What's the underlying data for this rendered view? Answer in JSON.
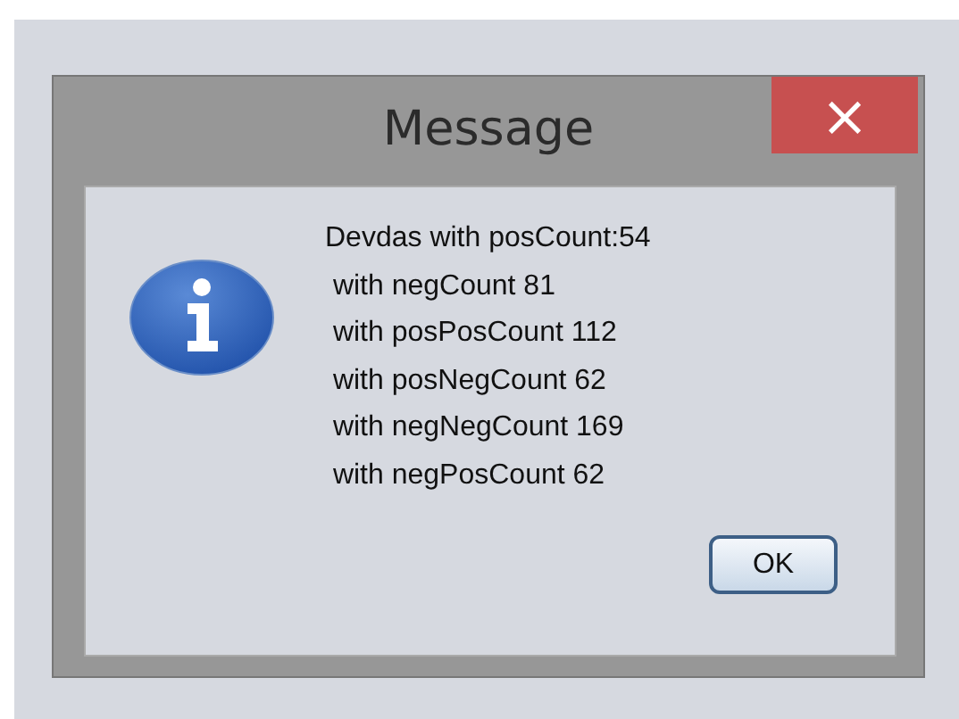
{
  "window": {
    "title": "Message",
    "close": "×"
  },
  "message_lines": [
    "Devdas with posCount:54",
    " with negCount 81",
    " with posPosCount 112",
    " with posNegCount 62",
    " with negNegCount 169",
    " with negPosCount 62"
  ],
  "buttons": [
    "OK"
  ]
}
